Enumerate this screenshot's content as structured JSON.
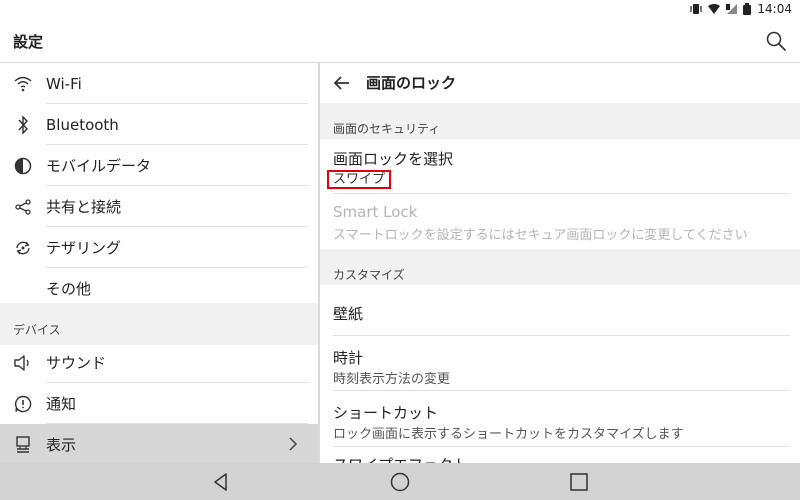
{
  "status_bar": {
    "time": "14:04"
  },
  "app": {
    "title": "設定"
  },
  "left_pane": {
    "items_top": [
      {
        "label": "Wi-Fi",
        "icon": "wifi-icon"
      },
      {
        "label": "Bluetooth",
        "icon": "bluetooth-icon"
      },
      {
        "label": "モバイルデータ",
        "icon": "mobile-data-icon"
      },
      {
        "label": "共有と接続",
        "icon": "share-icon"
      },
      {
        "label": "テザリング",
        "icon": "tethering-icon"
      },
      {
        "label": "その他",
        "icon": ""
      }
    ],
    "section_device": "デバイス",
    "items_device": [
      {
        "label": "サウンド",
        "icon": "speaker-icon"
      },
      {
        "label": "通知",
        "icon": "notification-icon"
      },
      {
        "label": "表示",
        "icon": "display-icon",
        "selected": true
      }
    ]
  },
  "right_pane": {
    "title": "画面のロック",
    "section_security": "画面のセキュリティ",
    "screen_lock": {
      "title": "画面ロックを選択",
      "value": "スワイプ"
    },
    "smart_lock": {
      "title": "Smart Lock",
      "subtitle": "スマートロックを設定するにはセキュア画面ロックに変更してください"
    },
    "section_customize": "カスタマイズ",
    "wallpaper": {
      "title": "壁紙"
    },
    "clock": {
      "title": "時計",
      "subtitle": "時刻表示方法の変更"
    },
    "shortcut": {
      "title": "ショートカット",
      "subtitle": "ロック画面に表示するショートカットをカスタマイズします"
    },
    "swipe_effect": {
      "title": "スワイプエフェクト"
    }
  },
  "colors": {
    "highlight_box": "#e00010",
    "selected_bg": "#d7d7d7",
    "section_bg": "#f1f1f1",
    "navbar_bg": "#d3d3d3"
  }
}
